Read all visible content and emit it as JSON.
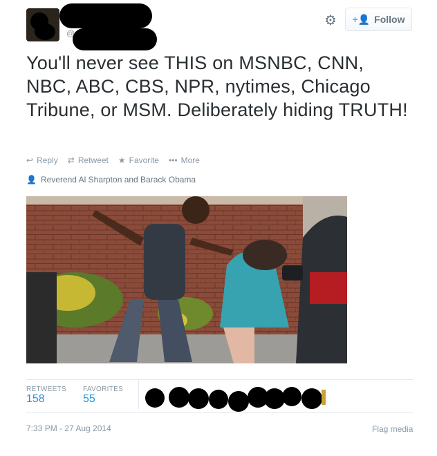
{
  "header": {
    "handle_prefix": "@",
    "follow_label": "Follow",
    "follow_icon": "add-user-icon",
    "settings_icon": "gear-icon"
  },
  "tweet": {
    "text": "You'll never see THIS on MSNBC, CNN, NBC, ABC, CBS, NPR, nytimes, Chicago Tribune, or MSM. Deliberately hiding TRUTH!",
    "actions": {
      "reply": "Reply",
      "retweet": "Retweet",
      "favorite": "Favorite",
      "more": "More"
    },
    "photo_tagged": "Reverend Al Sharpton and Barack Obama"
  },
  "stats": {
    "retweets_label": "RETWEETS",
    "retweets_count": "158",
    "favorites_label": "FAVORITES",
    "favorites_count": "55"
  },
  "footer": {
    "timestamp": "7:33 PM - 27 Aug 2014",
    "flag_label": "Flag media"
  },
  "colors": {
    "link_blue": "#1b95e0",
    "follow_blue": "#55acee",
    "muted": "#8899a6"
  }
}
